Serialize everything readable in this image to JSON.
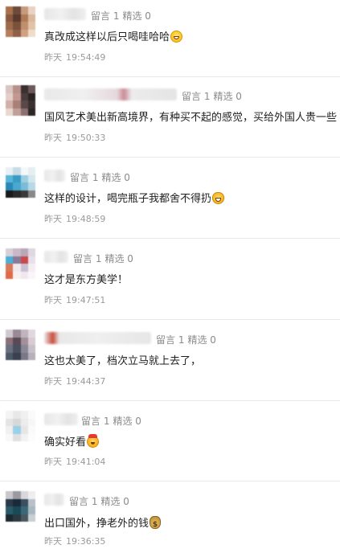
{
  "comments": [
    {
      "meta": {
        "reply": "留言 1",
        "featured": "精选 0"
      },
      "content": "真改成这样以后只喝哇哈哈",
      "emoji": "grin-emoji",
      "date": "昨天",
      "time": "19:54:49"
    },
    {
      "meta": {
        "reply": "留言 1",
        "featured": "精选 0"
      },
      "content": "国风艺术美出新高境界，有种买不起的感觉，买给外国人贵一些",
      "emoji": "",
      "date": "昨天",
      "time": "19:50:33"
    },
    {
      "meta": {
        "reply": "留言 1",
        "featured": "精选 0"
      },
      "content": "这样的设计，喝完瓶子我都舍不得扔",
      "emoji": "grinning-cat-emoji",
      "date": "昨天",
      "time": "19:48:59"
    },
    {
      "meta": {
        "reply": "留言 1",
        "featured": "精选 0"
      },
      "content": "这才是东方美学！",
      "emoji": "",
      "date": "昨天",
      "time": "19:47:51"
    },
    {
      "meta": {
        "reply": "留言 1",
        "featured": "精选 0"
      },
      "content": "这也太美了，档次立马就上去了，",
      "emoji": "",
      "date": "昨天",
      "time": "19:44:37"
    },
    {
      "meta": {
        "reply": "留言 1",
        "featured": "精选 0"
      },
      "content": "确实好看",
      "emoji": "party-emoji",
      "date": "昨天",
      "time": "19:41:04"
    },
    {
      "meta": {
        "reply": "留言 1",
        "featured": "精选 0"
      },
      "content": "出口国外，挣老外的钱",
      "emoji": "money-bag-emoji",
      "date": "昨天",
      "time": "19:36:35"
    }
  ],
  "colors": {
    "meta_text": "#8a8a8a",
    "time_text": "#9a9a9a",
    "content_text": "#1f1f1f",
    "divider": "#e9e9e9"
  }
}
